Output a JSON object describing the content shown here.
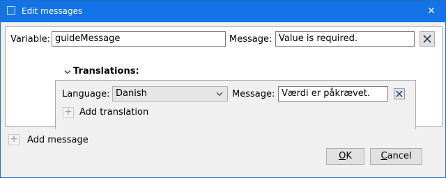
{
  "window": {
    "title": "Edit messages",
    "close_glyph": "✕"
  },
  "message": {
    "variable_label": "Variable:",
    "variable_value": "guideMessage",
    "message_label": "Message:",
    "message_value": "Value is required."
  },
  "translations": {
    "header": "Translations:",
    "language_label": "Language:",
    "language_value": "Danish",
    "message_label": "Message:",
    "message_value": "Værdi er påkrævet.",
    "add_label": "Add translation"
  },
  "add_message_label": "Add message",
  "buttons": {
    "ok_mnemonic": "O",
    "ok_rest": "K",
    "cancel_mnemonic": "C",
    "cancel_rest": "ancel"
  },
  "icons": {
    "remove": "close-x-icon",
    "expand": "chevron-down-icon",
    "add": "plus-icon"
  }
}
